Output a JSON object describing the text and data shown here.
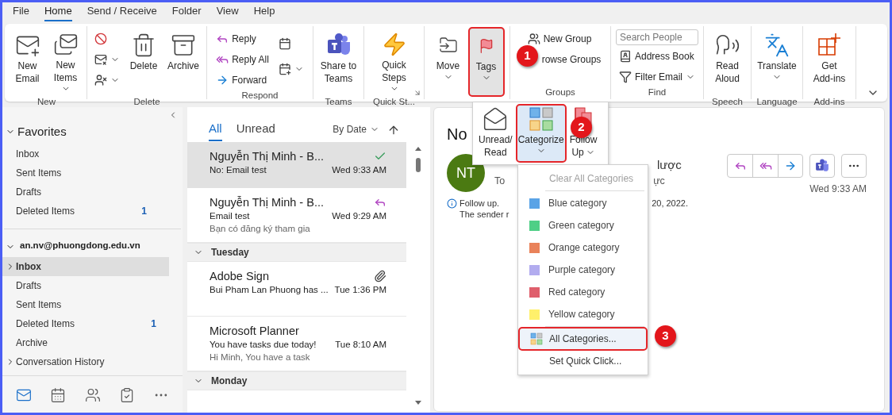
{
  "menu_tabs": [
    {
      "label": "File",
      "selected": false
    },
    {
      "label": "Home",
      "selected": true
    },
    {
      "label": "Send / Receive",
      "selected": false
    },
    {
      "label": "Folder",
      "selected": false
    },
    {
      "label": "View",
      "selected": false
    },
    {
      "label": "Help",
      "selected": false
    }
  ],
  "ribbon": {
    "groups": [
      {
        "label": "New",
        "buttons": [
          {
            "lines": [
              "New",
              "Email"
            ],
            "dropdown": false
          },
          {
            "lines": [
              "New",
              "Items"
            ],
            "dropdown": true
          }
        ]
      },
      {
        "label": "Delete",
        "small_buttons": [
          {
            "dropdown": false
          },
          {
            "dropdown": true
          },
          {
            "dropdown": true
          }
        ],
        "buttons": [
          {
            "lines": [
              "Delete"
            ],
            "dropdown": false
          },
          {
            "lines": [
              "Archive"
            ],
            "dropdown": false
          }
        ]
      },
      {
        "label": "Respond",
        "small_buttons": [
          {
            "label": "Reply"
          },
          {
            "label": "Reply All"
          },
          {
            "label": "Forward"
          }
        ],
        "icon_buttons": [
          {
            "dropdown": false
          },
          {
            "dropdown": true
          }
        ]
      },
      {
        "label": "Teams",
        "buttons": [
          {
            "lines": [
              "Share to",
              "Teams"
            ],
            "dropdown": false
          }
        ]
      },
      {
        "label": "Quick St...",
        "launcher": true,
        "buttons": [
          {
            "lines": [
              "Quick",
              "Steps"
            ],
            "dropdown": true
          }
        ]
      },
      {
        "buttons": [
          {
            "lines": [
              "Move"
            ],
            "dropdown": true,
            "selected": false,
            "annotated": false
          },
          {
            "lines": [
              "Tags"
            ],
            "dropdown": true,
            "selected": true,
            "annotated": true
          }
        ]
      },
      {
        "label": "Groups",
        "small_buttons": [
          {
            "label": "New Group"
          },
          {
            "label": "rowse Groups"
          }
        ]
      },
      {
        "label": "Find",
        "search": {
          "placeholder": "Search People"
        },
        "small_buttons": [
          {
            "label": "Address Book",
            "dropdown": false
          },
          {
            "label": "Filter Email",
            "dropdown": true
          }
        ]
      },
      {
        "label": "Speech",
        "buttons": [
          {
            "lines": [
              "Read",
              "Aloud"
            ],
            "dropdown": false
          }
        ]
      },
      {
        "label": "Language",
        "buttons": [
          {
            "lines": [
              "Translate"
            ],
            "dropdown": true
          }
        ]
      },
      {
        "label": "Add-ins",
        "buttons": [
          {
            "lines": [
              "Get",
              "Add-ins"
            ],
            "dropdown": false
          }
        ]
      }
    ]
  },
  "folder_pane": {
    "favorites": {
      "label": "Favorites",
      "expanded": true,
      "items": [
        {
          "label": "Inbox",
          "selected": false
        },
        {
          "label": "Sent Items",
          "selected": false
        },
        {
          "label": "Drafts",
          "selected": false
        },
        {
          "label": "Deleted Items",
          "selected": false,
          "count": "1"
        }
      ]
    },
    "account": {
      "label": "an.nv@phuongdong.edu.vn",
      "expanded": true,
      "folders": [
        {
          "label": "Inbox",
          "selected": true,
          "has_children": true
        },
        {
          "label": "Drafts",
          "selected": false,
          "has_children": false
        },
        {
          "label": "Sent Items",
          "selected": false,
          "has_children": false
        },
        {
          "label": "Deleted Items",
          "selected": false,
          "has_children": false,
          "count": "1"
        },
        {
          "label": "Archive",
          "selected": false,
          "has_children": false
        },
        {
          "label": "Conversation History",
          "selected": false,
          "has_children": true
        }
      ]
    },
    "nav": [
      {
        "selected": true
      },
      {
        "selected": false
      },
      {
        "selected": false
      },
      {
        "selected": false
      },
      {
        "selected": false
      }
    ]
  },
  "message_list": {
    "filters": [
      {
        "label": "All",
        "selected": true
      },
      {
        "label": "Unread",
        "selected": false
      }
    ],
    "sort": "By Date",
    "items": [
      {
        "kind": "message",
        "sender": "Nguyễn Thị Minh - B...",
        "subject": "No: Email test",
        "time": "Wed 9:33 AM",
        "selected": true
      },
      {
        "kind": "message",
        "sender": "Nguyễn Thị Minh - B...",
        "subject": "Email test",
        "time": "Wed 9:29 AM",
        "preview": "Bạn có đăng ký tham gia",
        "selected": false
      },
      {
        "kind": "header",
        "label": "Tuesday",
        "expanded": true
      },
      {
        "kind": "message",
        "sender": "Adobe Sign",
        "subject": "Bui Pham Lan Phuong has ...",
        "time": "Tue 1:36 PM",
        "selected": false
      },
      {
        "kind": "message",
        "sender": "Microsoft Planner",
        "subject": "You have tasks due today!",
        "time": "Tue 8:10 AM",
        "preview": "Hi Minh,  You have a task",
        "selected": false
      },
      {
        "kind": "header",
        "label": "Monday",
        "expanded": true
      }
    ]
  },
  "reading_pane": {
    "title": "No",
    "avatar": "NT",
    "subject_tail": "lược",
    "to_label": "To",
    "to_tail": "ực",
    "info": "Follow up.",
    "info_tail": "20, 2022.",
    "info_line2": "The sender r",
    "time": "Wed 9:33 AM"
  },
  "tags_popup": {
    "buttons": [
      {
        "lines": [
          "Unread/",
          "Read"
        ],
        "dropdown": false,
        "selected": false,
        "annotated": false
      },
      {
        "lines": [
          "Categorize"
        ],
        "dropdown": true,
        "selected": true,
        "annotated": true
      },
      {
        "lines": [
          "Follow",
          "Up"
        ],
        "dropdown": true,
        "selected": false,
        "annotated": false
      }
    ]
  },
  "categorize_menu": {
    "items": [
      {
        "kind": "command",
        "label": "Clear All Categories",
        "disabled": true,
        "selected": false,
        "annotated": false
      },
      {
        "kind": "separator"
      },
      {
        "kind": "category",
        "label": "Blue category",
        "color": "#5aa3e6"
      },
      {
        "kind": "category",
        "label": "Green category",
        "color": "#4fcf86"
      },
      {
        "kind": "category",
        "label": "Orange category",
        "color": "#e9825a"
      },
      {
        "kind": "category",
        "label": "Purple category",
        "color": "#b2acef"
      },
      {
        "kind": "category",
        "label": "Red category",
        "color": "#df5f6c"
      },
      {
        "kind": "category",
        "label": "Yellow category",
        "color": "#fff06b"
      },
      {
        "kind": "separator"
      },
      {
        "kind": "command",
        "label": "All Categories...",
        "disabled": false,
        "selected": true,
        "annotated": true,
        "icon": true
      },
      {
        "kind": "command",
        "label": "Set Quick Click...",
        "disabled": false,
        "selected": false,
        "annotated": false
      }
    ]
  },
  "callouts": [
    {
      "number": "1"
    },
    {
      "number": "2"
    },
    {
      "number": "3"
    }
  ]
}
